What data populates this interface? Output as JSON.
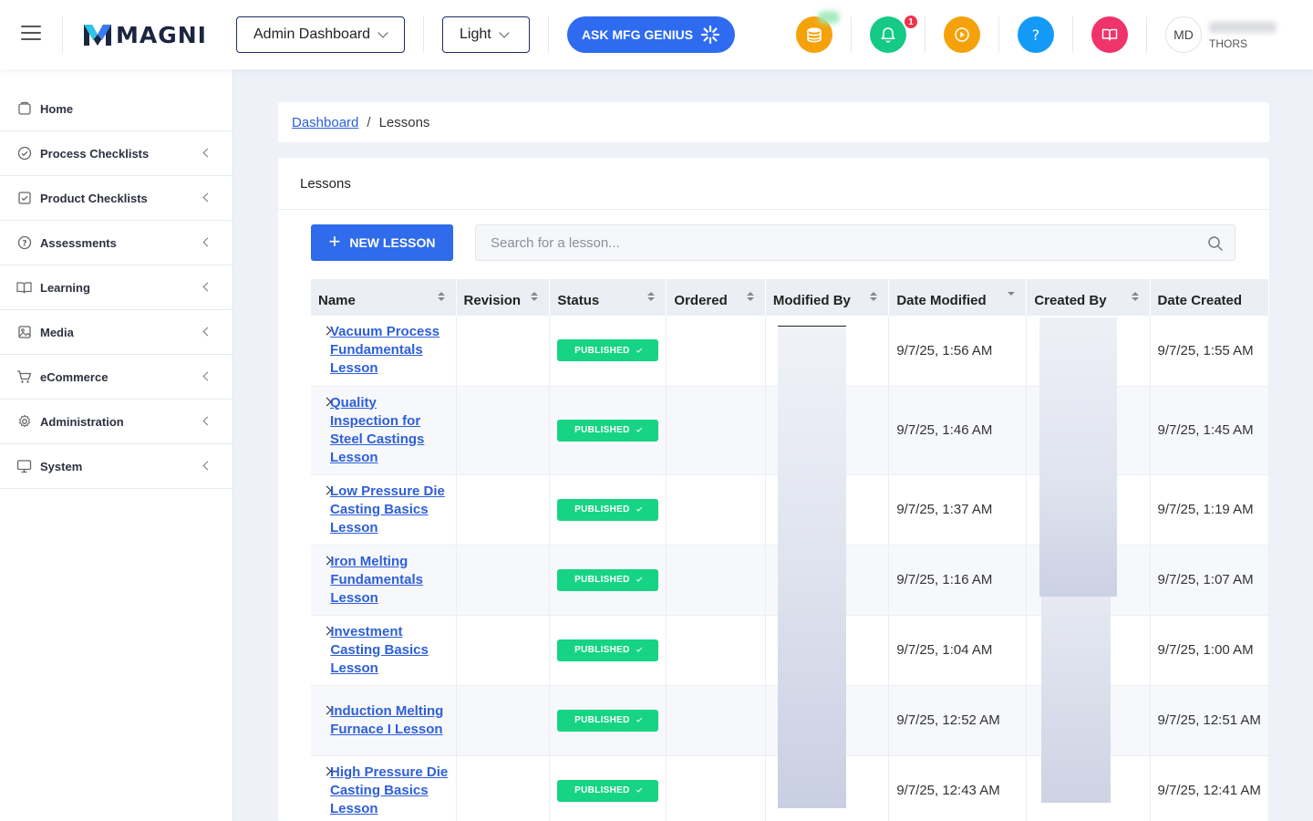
{
  "header": {
    "logo_text": "MAGNI",
    "dashboard_select": "Admin Dashboard",
    "theme_select": "Light",
    "ask_button": "ASK MFG GENIUS",
    "notification_count": "1",
    "avatar_initials": "MD",
    "user_org": "THORS",
    "icon_colors": {
      "coins": "#f5a20a",
      "bell": "#15c987",
      "play": "#f5a20a",
      "help": "#139af7",
      "book": "#f0336a"
    }
  },
  "sidebar": {
    "items": [
      {
        "label": "Home",
        "icon": "home-icon",
        "has_submenu": false
      },
      {
        "label": "Process Checklists",
        "icon": "check-circle-icon",
        "has_submenu": true
      },
      {
        "label": "Product Checklists",
        "icon": "check-square-icon",
        "has_submenu": true
      },
      {
        "label": "Assessments",
        "icon": "question-circle-icon",
        "has_submenu": true
      },
      {
        "label": "Learning",
        "icon": "book-open-icon",
        "has_submenu": true
      },
      {
        "label": "Media",
        "icon": "image-icon",
        "has_submenu": true
      },
      {
        "label": "eCommerce",
        "icon": "cart-icon",
        "has_submenu": true
      },
      {
        "label": "Administration",
        "icon": "settings-icon",
        "has_submenu": true
      },
      {
        "label": "System",
        "icon": "monitor-icon",
        "has_submenu": true
      }
    ]
  },
  "breadcrumb": {
    "parent": "Dashboard",
    "separator": "/",
    "current": "Lessons"
  },
  "lessons": {
    "title": "Lessons",
    "new_button": "NEW LESSON",
    "search_placeholder": "Search for a lesson...",
    "columns": [
      "Name",
      "Revision",
      "Status",
      "Ordered",
      "Modified By",
      "Date Modified",
      "Created By",
      "Date Created"
    ],
    "rows": [
      {
        "name": "Vacuum Process Fundamentals Lesson",
        "revision": "",
        "status": "PUBLISHED",
        "ordered": "",
        "date_modified": "9/7/25, 1:56 AM",
        "date_created": "9/7/25, 1:55 AM"
      },
      {
        "name": "Quality Inspection for Steel Castings Lesson",
        "revision": "",
        "status": "PUBLISHED",
        "ordered": "",
        "date_modified": "9/7/25, 1:46 AM",
        "date_created": "9/7/25, 1:45 AM"
      },
      {
        "name": "Low Pressure Die Casting Basics Lesson",
        "revision": "",
        "status": "PUBLISHED",
        "ordered": "",
        "date_modified": "9/7/25, 1:37 AM",
        "date_created": "9/7/25, 1:19 AM"
      },
      {
        "name": "Iron Melting Fundamentals Lesson",
        "revision": "",
        "status": "PUBLISHED",
        "ordered": "",
        "date_modified": "9/7/25, 1:16 AM",
        "date_created": "9/7/25, 1:07 AM"
      },
      {
        "name": "Investment Casting Basics Lesson",
        "revision": "",
        "status": "PUBLISHED",
        "ordered": "",
        "date_modified": "9/7/25, 1:04 AM",
        "date_created": "9/7/25, 1:00 AM"
      },
      {
        "name": "Induction Melting Furnace I Lesson",
        "revision": "",
        "status": "PUBLISHED",
        "ordered": "",
        "date_modified": "9/7/25, 12:52 AM",
        "date_created": "9/7/25, 12:51 AM"
      },
      {
        "name": "High Pressure Die Casting Basics Lesson",
        "revision": "",
        "status": "PUBLISHED",
        "ordered": "",
        "date_modified": "9/7/25, 12:43 AM",
        "date_created": "9/7/25, 12:41 AM"
      }
    ]
  }
}
